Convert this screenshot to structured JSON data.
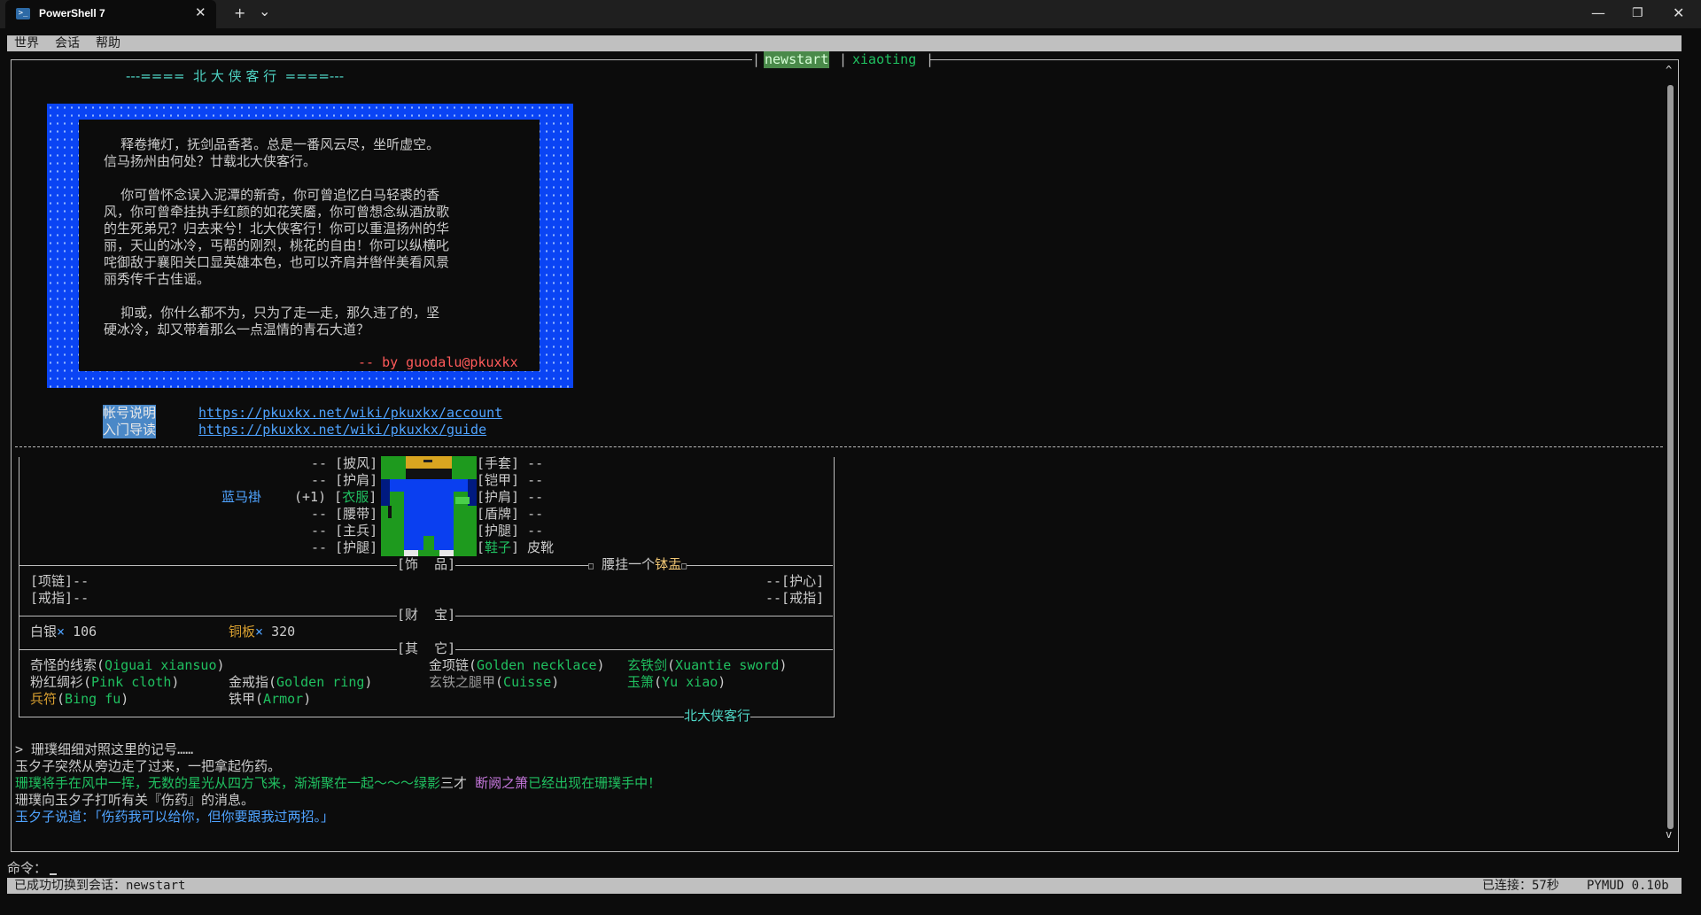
{
  "window": {
    "tab_title": "PowerShell 7",
    "tab_icon": "terminal-icon",
    "close_tab_glyph": "✕",
    "new_tab_glyph": "+",
    "dropdown_glyph": "⌄",
    "minimize_glyph": "—",
    "restore_glyph": "❐",
    "close_glyph": "✕"
  },
  "menu": [
    "世界",
    "会话",
    "帮助"
  ],
  "sessions": [
    "newstart",
    "xiaoting"
  ],
  "active_session": "newstart",
  "banner": "---====  北 大 侠 客 行  ====---",
  "intro": {
    "lines": [
      "    释卷掩灯，抚剑品香茗。总是一番风云尽，坐听虚空。",
      "信马扬州由何处？廿载北大侠客行。",
      "",
      "    你可曾怀念误入泥潭的新奇，你可曾追忆白马轻裘的香",
      "风，你可曾牵挂执手红颜的如花笑靥，你可曾想念纵酒放歌",
      "的生死弟兄？归去来兮！北大侠客行！你可以重温扬州的华",
      "丽，天山的冰冷，丐帮的刚烈，桃花的自由！你可以纵横叱",
      "咤御敌于襄阳关口显英雄本色，也可以齐肩并辔伴美看风景",
      "丽秀传千古佳谣。",
      "",
      "    抑或，你什么都不为，只为了走一走，那久违了的，坚",
      "硬冰冷，却又带着那么一点温情的青石大道？"
    ],
    "signature": "-- by guodalu@pkuxkx"
  },
  "links": [
    {
      "label": "帐号说明",
      "url": "https://pkuxkx.net/wiki/pkuxkx/account"
    },
    {
      "label": "入门导读",
      "url": "https://pkuxkx.net/wiki/pkuxkx/guide"
    }
  ],
  "equipment": {
    "left_slots": [
      {
        "prefix": "--",
        "slot": "披风"
      },
      {
        "prefix": "--",
        "slot": "护肩"
      },
      {
        "prefix": "(+1)",
        "slot": "衣服"
      },
      {
        "prefix": "--",
        "slot": "腰带"
      },
      {
        "prefix": "--",
        "slot": "主兵"
      },
      {
        "prefix": "--",
        "slot": "护腿"
      }
    ],
    "worn_item": "蓝马褂",
    "right_slots": [
      {
        "slot": "手套",
        "value": "--"
      },
      {
        "slot": "铠甲",
        "value": "--"
      },
      {
        "slot": "护肩",
        "value": "--"
      },
      {
        "slot": "盾牌",
        "value": "--"
      },
      {
        "slot": "护腿",
        "value": "--"
      },
      {
        "slot": "鞋子",
        "value": "皮靴"
      }
    ],
    "accessories_header": "[饰  品]",
    "waist_note_prefix": "腰挂一个",
    "waist_note_item": "钵盂",
    "necklace": "[项链]--",
    "ring_left": "[戒指]--",
    "heart_guard": "--[护心]",
    "ring_right": "--[戒指]",
    "wealth_header": "[财  宝]",
    "silver_label": "白银",
    "silver_count": "106",
    "copper_label": "铜板",
    "copper_count": "320",
    "times_glyph": "×",
    "other_header": "[其  它]",
    "items": [
      {
        "cn": "奇怪的线索",
        "en": "Qiguai xiansuo"
      },
      {
        "cn": "金项链",
        "en": "Golden necklace"
      },
      {
        "cn": "玄铁剑",
        "en": "Xuantie sword"
      },
      {
        "cn": "粉红绸衫",
        "en": "Pink cloth"
      },
      {
        "cn": "金戒指",
        "en": "Golden ring"
      },
      {
        "cn": "玄铁之腿甲",
        "en": "Cuisse"
      },
      {
        "cn": "玉箫",
        "en": "Yu xiao"
      },
      {
        "cn": "兵符",
        "en": "Bing fu"
      },
      {
        "cn": "铁甲",
        "en": "Armor"
      }
    ],
    "footer": "北大侠客行"
  },
  "messages": [
    "> 珊璞细细对照这里的记号……",
    "玉夕子突然从旁边走了过来，一把拿起伤药。",
    "珊璞将手在风中一挥，无数的星光从四方飞来，渐渐聚在一起～～～绿影",
    "三才",
    "断阙之箫",
    "已经出现在珊璞手中！",
    "珊璞向玉夕子打听有关『伤药』的消息。",
    "玉夕子说道：「伤药我可以给你，但你要跟我过两招。」"
  ],
  "command_prompt": "命令：",
  "status": {
    "left": "已成功切换到会话：newstart",
    "connected": "已连接：57秒",
    "app": "PYMUD 0.10b"
  },
  "colors": {
    "background": "#0c0c0c",
    "green": "#20c060",
    "blue": "#4fa3ff",
    "intro_blue": "#0a44f4",
    "signature": "#ff5a5a"
  }
}
